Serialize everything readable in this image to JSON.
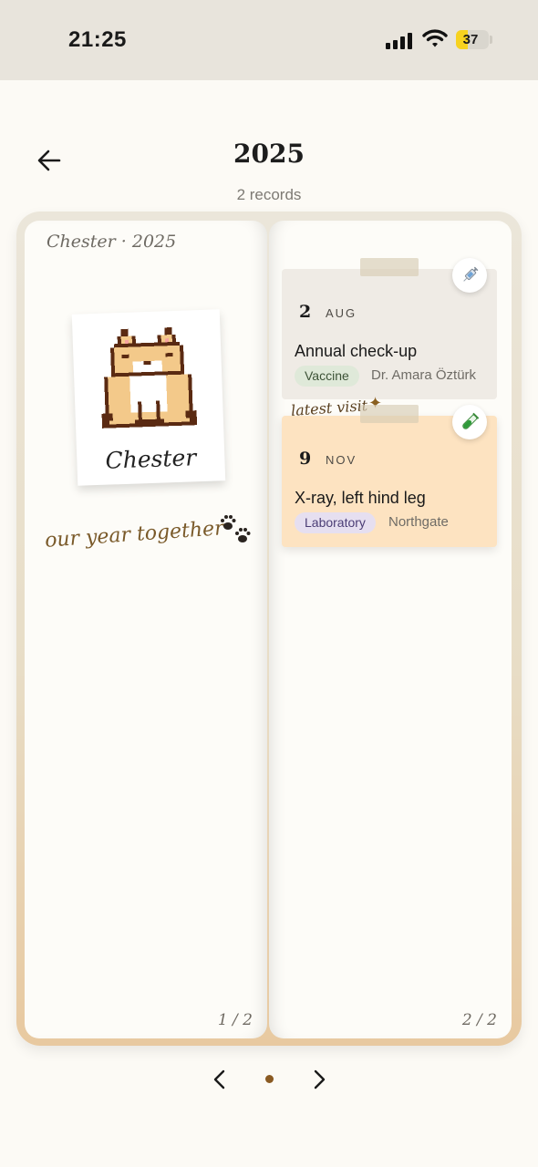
{
  "status_bar": {
    "time": "21:25",
    "battery_percent": "37",
    "battery_level": 0.37,
    "battery_color": "#f7d21f"
  },
  "header": {
    "back_icon": "arrow-left-icon",
    "title": "2025",
    "subtitle": "2 records"
  },
  "left_page": {
    "header": "Chester · 2025",
    "photo_caption": "Chester",
    "tagline": "our year together",
    "tagline_icon": "paw-prints-icon",
    "page_number": "1 / 2"
  },
  "right_page": {
    "page_number": "2 / 2",
    "records": [
      {
        "day": "2",
        "month": "AUG",
        "title": "Annual check-up",
        "category": "Vaccine",
        "category_color": "#dfe9d9",
        "provider": "Dr. Amara Öztürk",
        "icon": "syringe-icon"
      },
      {
        "day": "9",
        "month": "NOV",
        "title": "X-ray, left hind leg",
        "category": "Laboratory",
        "category_color": "#e6dff0",
        "provider": "Northgate",
        "icon": "test-tube-icon",
        "annotation": "latest visit"
      }
    ]
  },
  "pagination": {
    "current_page": 1,
    "total_dots": 1,
    "dot_color": "#8a5a22"
  }
}
